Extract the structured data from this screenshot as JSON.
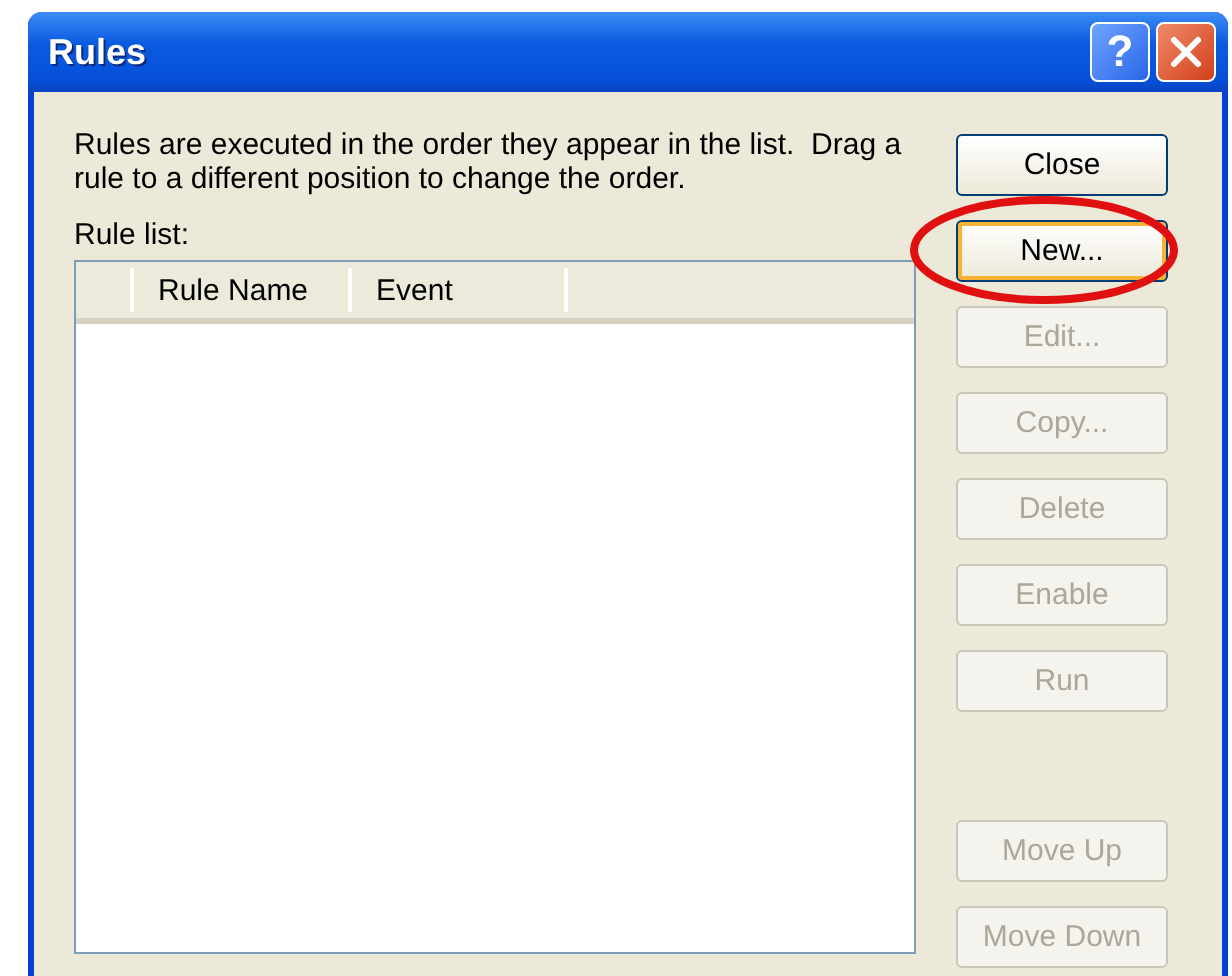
{
  "window": {
    "title": "Rules",
    "help_glyph": "?"
  },
  "description": "Rules are executed in the order they appear in the list.  Drag a rule to a different position to change the order.",
  "rule_list": {
    "label": "Rule list:",
    "columns": [
      "",
      "Rule Name",
      "Event"
    ]
  },
  "buttons": [
    {
      "label": "Close",
      "disabled": false,
      "focused": false,
      "highlighted": false
    },
    {
      "label": "New...",
      "disabled": false,
      "focused": true,
      "highlighted": true
    },
    {
      "label": "Edit...",
      "disabled": true,
      "focused": false,
      "highlighted": false
    },
    {
      "label": "Copy...",
      "disabled": true,
      "focused": false,
      "highlighted": false
    },
    {
      "label": "Delete",
      "disabled": true,
      "focused": false,
      "highlighted": false
    },
    {
      "label": "Enable",
      "disabled": true,
      "focused": false,
      "highlighted": false
    },
    {
      "label": "Run",
      "disabled": true,
      "focused": false,
      "highlighted": false
    }
  ],
  "move_buttons": [
    {
      "label": "Move Up",
      "disabled": true,
      "focused": false,
      "highlighted": false
    },
    {
      "label": "Move Down",
      "disabled": true,
      "focused": false,
      "highlighted": false
    }
  ]
}
